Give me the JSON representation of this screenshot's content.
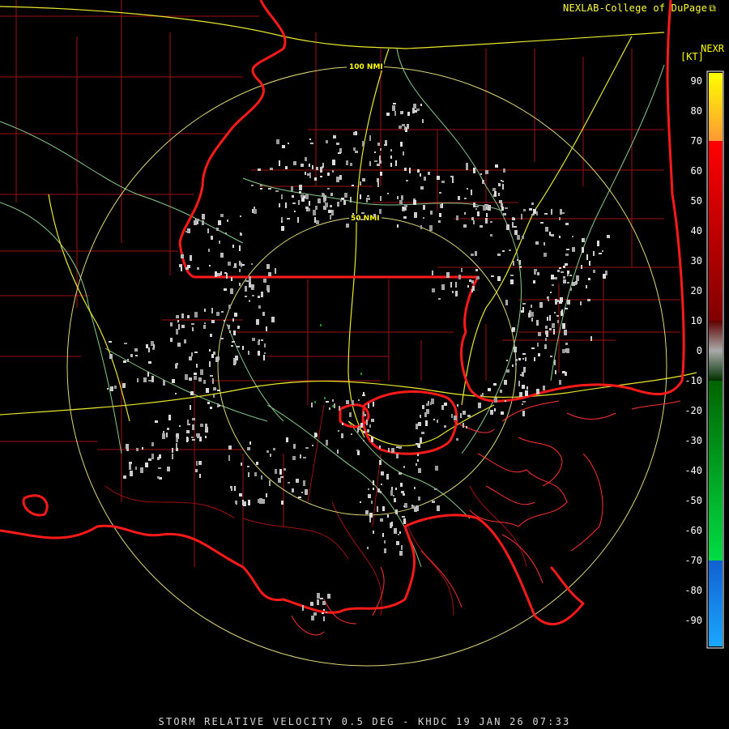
{
  "credit": {
    "text": "NEXLAB-College of DuPage",
    "icon": "external-link-icon"
  },
  "product_code": "NEXR",
  "units_label": "[KT]",
  "footer": "STORM RELATIVE VELOCITY 0.5 DEG - KHDC 19 JAN 26 07:33",
  "range_rings": [
    {
      "label": "50 NMI"
    },
    {
      "label": "100 NMI"
    }
  ],
  "colorbar": {
    "ticks": [
      "90",
      "80",
      "70",
      "60",
      "50",
      "40",
      "30",
      "20",
      "10",
      "0",
      "-10",
      "-20",
      "-30",
      "-40",
      "-50",
      "-60",
      "-70",
      "-80",
      "-90"
    ],
    "colors": {
      "high_yellow": "#ffff00",
      "orange": "#ff9933",
      "red": "#ff0000",
      "dark_red": "#800000",
      "gray": "#aaaaaa",
      "dark_green": "#006400",
      "green": "#00dd44",
      "blue": "#1060d0",
      "light_blue": "#1aa8ff"
    }
  },
  "map_colors": {
    "state_border": "#ff2020",
    "county_border": "#b01010",
    "highway": "#dddd33",
    "road": "#88cc88",
    "range_ring": "#e8e07a"
  }
}
